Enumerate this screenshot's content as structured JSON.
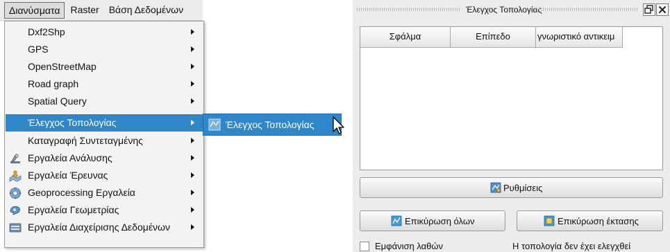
{
  "menubar": {
    "items": [
      {
        "label": "Διανύσματα"
      },
      {
        "label": "Raster"
      },
      {
        "label": "Βάση Δεδομένων"
      }
    ]
  },
  "dropdown": {
    "items": [
      {
        "label": "Dxf2Shp",
        "icon": ""
      },
      {
        "label": "GPS",
        "icon": ""
      },
      {
        "label": "OpenStreetMap",
        "icon": ""
      },
      {
        "label": "Road graph",
        "icon": ""
      },
      {
        "label": "Spatial Query",
        "icon": ""
      },
      {
        "label": "Έλεγχος Τοπολογίας",
        "icon": "",
        "selected": true
      },
      {
        "label": "Καταγραφή Συντεταγμένης",
        "icon": ""
      },
      {
        "label": "Εργαλεία Ανάλυσης",
        "icon": "analysis-tools-icon"
      },
      {
        "label": "Εργαλεία Έρευνας",
        "icon": "research-tools-icon"
      },
      {
        "label": "Geoprocessing Εργαλεία",
        "icon": "geoprocessing-tools-icon"
      },
      {
        "label": "Εργαλεία Γεωμετρίας",
        "icon": "geometry-tools-icon"
      },
      {
        "label": "Εργαλεία Διαχείρισης Δεδομένων",
        "icon": "data-management-tools-icon"
      }
    ]
  },
  "submenu": {
    "label": "Έλεγχος Τοπολογίας",
    "icon": "topology-checker-icon"
  },
  "panel": {
    "title": "Έλεγχος Τοπολογίας",
    "columns": [
      "Σφάλμα",
      "Επίπεδο",
      "γνωριστικό αντικειμ"
    ],
    "settings_label": "Ρυθμίσεις",
    "validate_all_label": "Επικύρωση όλων",
    "validate_extent_label": "Επικύρωση έκτασης",
    "show_errors_label": "Εμφάνιση λαθών",
    "status": "Η τοπολογία δεν έχει ελεγχθεί"
  },
  "colors": {
    "selection": "#2f86c9",
    "panel_bg": "#ececec"
  }
}
